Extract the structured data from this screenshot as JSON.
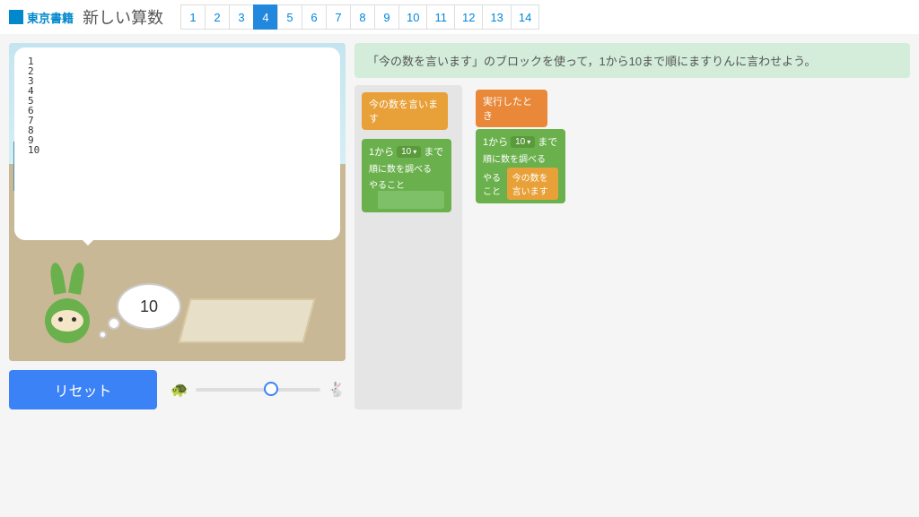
{
  "header": {
    "publisher": "東京書籍",
    "title": "新しい算数",
    "pages": [
      "1",
      "2",
      "3",
      "4",
      "5",
      "6",
      "7",
      "8",
      "9",
      "10",
      "11",
      "12",
      "13",
      "14"
    ],
    "active_page_index": 3
  },
  "stage": {
    "output_lines": "1\n2\n3\n4\n5\n6\n7\n8\n9\n10",
    "thought_value": "10"
  },
  "controls": {
    "reset_label": "リセット"
  },
  "instruction": {
    "text": "「今の数を言います」のブロックを使って，1から10まで順にますりんに言わせよう。"
  },
  "blocks": {
    "say_now": "今の数を言います",
    "exec_when": "実行したとき",
    "loop_from": "1から",
    "loop_count": "10",
    "loop_to": "まで",
    "loop_order": "順に数を調べる",
    "loop_do": "やること"
  }
}
